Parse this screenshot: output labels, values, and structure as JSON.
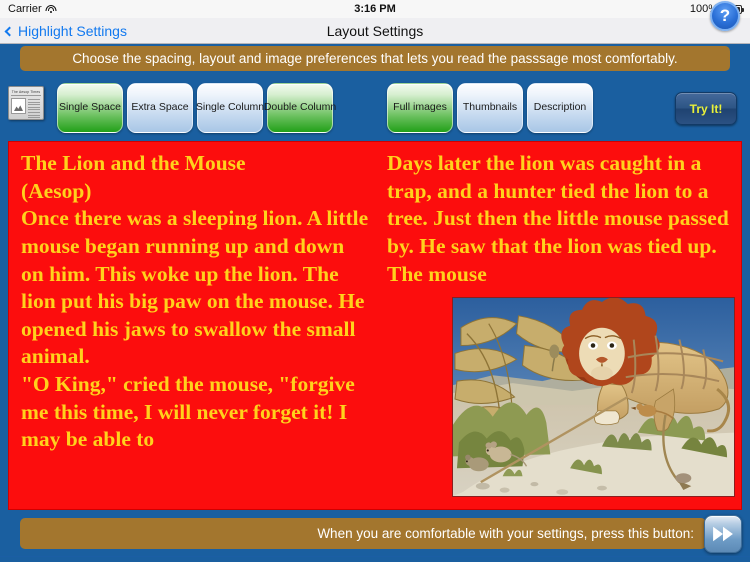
{
  "status_bar": {
    "carrier": "Carrier",
    "wifi_icon": "wifi-icon",
    "time": "3:16 PM",
    "battery_percent": "100%",
    "battery_icon": "battery-full-icon"
  },
  "nav_bar": {
    "back_label": "Highlight Settings",
    "back_icon": "chevron-left-icon",
    "title": "Layout Settings",
    "help_label": "?",
    "help_icon": "question-mark-circle-icon"
  },
  "instruction": {
    "text": "Choose the spacing, layout and image preferences that lets you read the passsage most comfortably."
  },
  "toolbar": {
    "preview_icon": "newspaper-icon",
    "newspaper_masthead": "The Aesop Times",
    "spacing_options": [
      {
        "label": "Single Space",
        "selected": true
      },
      {
        "label": "Extra Space",
        "selected": false
      }
    ],
    "column_options": [
      {
        "label": "Single Column",
        "selected": false
      },
      {
        "label": "Double Column",
        "selected": true
      }
    ],
    "image_options": [
      {
        "label": "Full images",
        "selected": true
      },
      {
        "label": "Thumbnails",
        "selected": false
      },
      {
        "label": "Description",
        "selected": false
      }
    ],
    "try_it_label": "Try It!",
    "selected_color": "#22a019",
    "unselected_color": "#a8c6e6",
    "try_it_text_color": "#e8f03a"
  },
  "reader": {
    "background_color": "#fc0d0d",
    "text_color": "#ffd21c",
    "column_left": [
      "The Lion and the Mouse",
      "(Aesop)",
      "Once there was a sleeping lion. A little mouse began running up and down on him. This woke up the lion. The lion put his big paw on the mouse. He opened his jaws to swallow the small animal.",
      "\"O King,\" cried the mouse, \"forgive me this time, I will never forget it! I may be able to"
    ],
    "column_right": [
      "Days later the lion was caught in a trap, and a hunter tied the lion to a tree. Just then the little mouse passed by. He saw that the lion was tied up. The mouse"
    ],
    "illustration_alt": "Lion tied up in ropes with mice nearby"
  },
  "bottom_bar": {
    "text": "When you are comfortable with your settings, press this button:",
    "next_icon": "fast-forward-icon"
  }
}
